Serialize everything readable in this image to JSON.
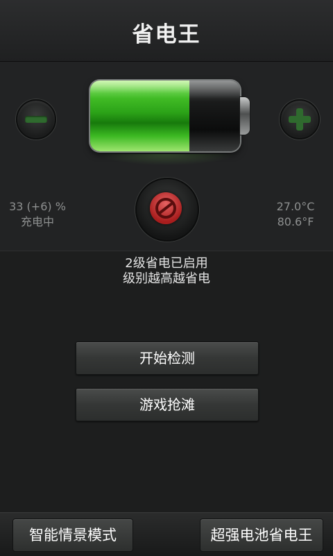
{
  "app": {
    "title": "省电王"
  },
  "battery": {
    "level_fraction": 0.66,
    "stats_left": {
      "percent": "33 (+6) %",
      "status": "充电中"
    },
    "stats_right": {
      "temp_c": "27.0°C",
      "temp_f": "80.6°F"
    }
  },
  "controls": {
    "minus_icon": "minus-icon",
    "plus_icon": "plus-icon",
    "mode_icon": "power-save-mode-icon"
  },
  "status": {
    "line1": "2级省电已启用",
    "line2": "级别越高越省电"
  },
  "actions": {
    "detect_label": "开始检测",
    "game_label": "游戏抢滩"
  },
  "bottom": {
    "scene_label": "智能情景模式",
    "super_label": "超强电池省电王"
  },
  "colors": {
    "battery_green": "#2ca318",
    "mode_red": "#a81d1d",
    "button_green": "#2f6a2e"
  }
}
